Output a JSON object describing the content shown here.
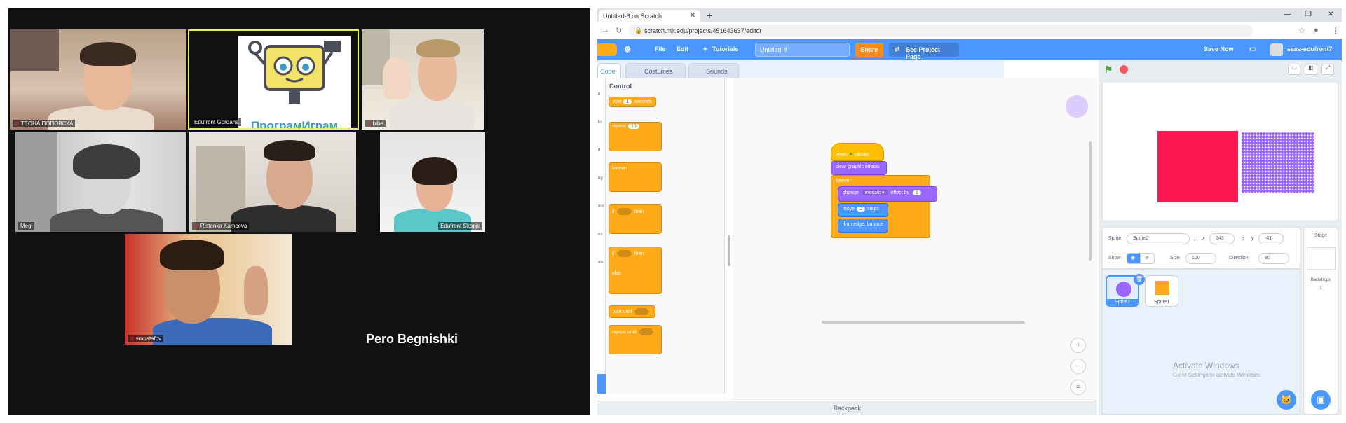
{
  "video_call": {
    "participants": [
      {
        "name": "ТЕОНА ПОПОВСКА"
      },
      {
        "name": "Edufront Gordana"
      },
      {
        "name": "bibe"
      },
      {
        "name": "Megi"
      },
      {
        "name": "Ristenka Kamceva"
      },
      {
        "name": "Edufront Skopje"
      },
      {
        "name": "smustafov"
      }
    ],
    "logo_text": "ПрограмИграм",
    "name_card": "Pero Begnishki"
  },
  "browser": {
    "tab_title": "Untitled-8 on Scratch",
    "url": "scratch.mit.edu/projects/451643637/editor"
  },
  "scratch": {
    "menu": {
      "file": "File",
      "edit": "Edit",
      "tutorials": "Tutorials",
      "project_title": "Untitled-8",
      "share": "Share",
      "see_project_page": "See Project Page",
      "save_now": "Save Now",
      "username": "sasa-edufront7"
    },
    "tabs": {
      "code": "Code",
      "costumes": "Costumes",
      "sounds": "Sounds"
    },
    "palette": {
      "category": "Control",
      "categories_partial": [
        "n",
        "ks",
        "d",
        "ng",
        "ors",
        "es",
        "ols"
      ],
      "wait": "wait",
      "wait_value": "1",
      "seconds": "seconds",
      "repeat": "repeat",
      "repeat_value": "10",
      "forever": "forever",
      "if": "if",
      "then": "then",
      "if2": "if",
      "then2": "then",
      "else": "else",
      "wait_until": "wait until",
      "repeat_until": "repeat until"
    },
    "script": {
      "when": "when",
      "clicked": "clicked",
      "clear_effects": "clear graphic effects",
      "forever": "forever",
      "change": "change",
      "effect": "mosaic",
      "effect_by": "effect by",
      "effect_value": "1",
      "move": "move",
      "move_value": "2",
      "steps": "steps",
      "bounce": "if on edge, bounce"
    },
    "backpack": "Backpack",
    "sprite_info": {
      "sprite_label": "Sprite",
      "sprite_name": "Sprite2",
      "x_label": "x",
      "x": "143",
      "y_label": "y",
      "y": "-41",
      "show_label": "Show",
      "size_label": "Size",
      "size": "100",
      "direction_label": "Direction",
      "direction": "90"
    },
    "sprites": [
      {
        "name": "Sprite2",
        "color": "#9966ff"
      },
      {
        "name": "Sprite1",
        "color": "#ffab19"
      }
    ],
    "stage_panel": {
      "title": "Stage",
      "backdrops_label": "Backdrops",
      "backdrops_count": "1"
    },
    "colors": {
      "scratch_blue": "#4c97ff",
      "control": "#ffab19",
      "looks": "#9966ff",
      "motion": "#4c97ff",
      "events": "#ffbf00",
      "stage_red": "#fd164f"
    }
  },
  "windows_watermark": {
    "line1": "Activate Windows",
    "line2": "Go to Settings to activate Windows."
  }
}
